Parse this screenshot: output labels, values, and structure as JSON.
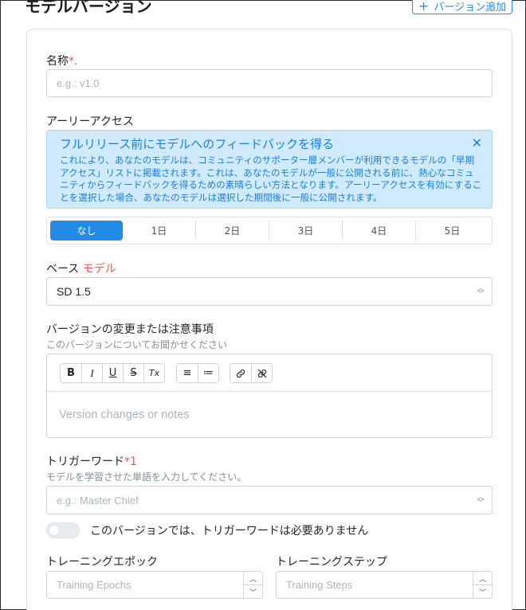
{
  "header": {
    "title": "モデルバージョン",
    "add_button_label": "バージョン追加"
  },
  "name_field": {
    "label": "名称",
    "required_mark": "*.",
    "placeholder": "e.g.: v1.0"
  },
  "early_access": {
    "label": "アーリーアクセス",
    "alert_title": "フルリリース前にモデルへのフィードバックを得る",
    "alert_body": "これにより、あなたのモデルは、コミュニティのサポーター層メンバーが利用できるモデルの「早期アクセス」リストに掲載されます。これは、あなたのモデルが一般に公開される前に、熱心なコミュニティからフィードバックを得るための素晴らしい方法となります。アーリーアクセスを有効にすることを選択した場合、あなたのモデルは選択した期間後に一般に公開されます。",
    "options": [
      "なし",
      "1日",
      "2日",
      "3日",
      "4日",
      "5日"
    ],
    "selected": "なし"
  },
  "base_model": {
    "label_prefix": "ベース",
    "label_accent": "モデル",
    "value": "SD 1.5"
  },
  "notes": {
    "label": "バージョンの変更または注意事項",
    "description": "このバージョンについてお聞かせください",
    "placeholder": "Version changes or notes",
    "toolbar": {
      "bold": "B",
      "italic": "I",
      "underline": "U",
      "strike": "S",
      "clear": "Tx",
      "bullet_list": "≡",
      "ordered_list": "≔",
      "link": "🔗",
      "unlink": "⛓"
    }
  },
  "trigger_words": {
    "label": "トリガーワード",
    "required_mark": "*1",
    "description": "モデルを学習させた単語を入力してください。",
    "placeholder": "e.g.: Master Chief"
  },
  "no_trigger_toggle": {
    "label": "このバージョンでは、トリガーワードは必要ありません",
    "checked": false
  },
  "training": {
    "epochs_label": "トレーニングエポック",
    "epochs_placeholder": "Training Epochs",
    "steps_label": "トレーニングステップ",
    "steps_placeholder": "Training Steps"
  },
  "colors": {
    "accent": "#228be6",
    "required": "#fa5252",
    "alert_bg": "#d0ebff",
    "alert_text": "#1c7ed6"
  }
}
